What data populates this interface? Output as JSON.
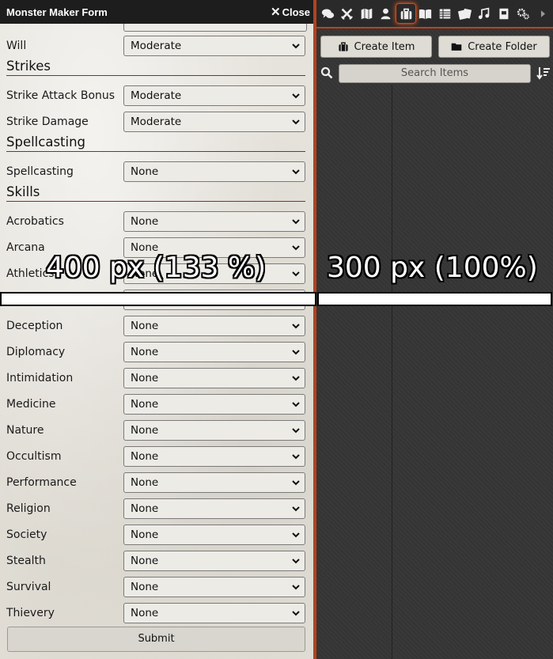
{
  "form_window": {
    "title": "Monster Maker Form",
    "close_label": "Close",
    "rows_top": [
      {
        "label": "Will",
        "value": "Moderate"
      }
    ],
    "sections": {
      "strikes": "Strikes",
      "spellcasting": "Spellcasting",
      "skills": "Skills"
    },
    "strike_rows": [
      {
        "label": "Strike Attack Bonus",
        "value": "Moderate"
      },
      {
        "label": "Strike Damage",
        "value": "Moderate"
      }
    ],
    "spell_rows": [
      {
        "label": "Spellcasting",
        "value": "None"
      }
    ],
    "skill_rows": [
      {
        "label": "Acrobatics",
        "value": "None"
      },
      {
        "label": "Arcana",
        "value": "None"
      },
      {
        "label": "Athletics",
        "value": "None"
      },
      {
        "label": "",
        "value": ""
      },
      {
        "label": "Deception",
        "value": "None"
      },
      {
        "label": "Diplomacy",
        "value": "None"
      },
      {
        "label": "Intimidation",
        "value": "None"
      },
      {
        "label": "Medicine",
        "value": "None"
      },
      {
        "label": "Nature",
        "value": "None"
      },
      {
        "label": "Occultism",
        "value": "None"
      },
      {
        "label": "Performance",
        "value": "None"
      },
      {
        "label": "Religion",
        "value": "None"
      },
      {
        "label": "Society",
        "value": "None"
      },
      {
        "label": "Stealth",
        "value": "None"
      },
      {
        "label": "Survival",
        "value": "None"
      },
      {
        "label": "Thievery",
        "value": "None"
      }
    ],
    "submit_label": "Submit"
  },
  "sidebar": {
    "tabs": [
      "chat-icon",
      "combat-icon",
      "map-icon",
      "actor-icon",
      "items-icon",
      "journal-icon",
      "tables-icon",
      "cards-icon",
      "music-icon",
      "compendium-icon",
      "settings-icon",
      "expand-arrow-icon"
    ],
    "active_tab": "items-icon",
    "create_item_label": "Create Item",
    "create_folder_label": "Create Folder",
    "search_placeholder": "Search Items"
  },
  "annotations": {
    "left_label": "400 px (133 %)",
    "right_label": "300 px (100%)"
  },
  "colors": {
    "accent": "#c2401a",
    "section_rule": "#8b2b1f",
    "titlebar": "#1d1d1d"
  }
}
